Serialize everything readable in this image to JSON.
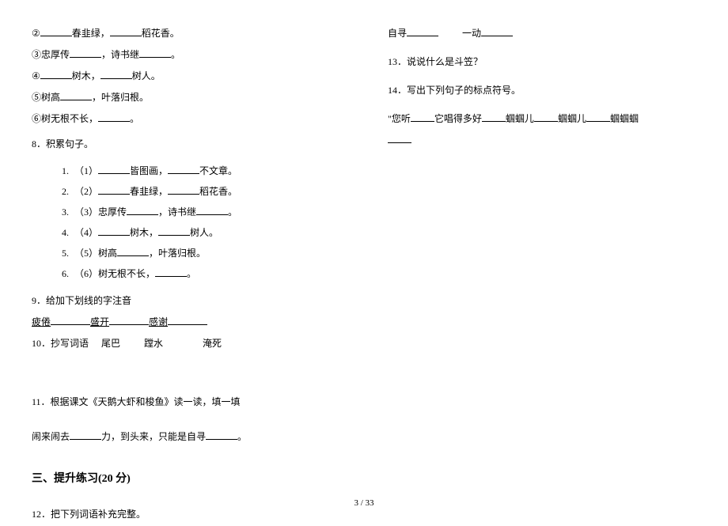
{
  "left": {
    "lines_top": {
      "l2": {
        "a": "②",
        "m": "春韭绿，",
        "e": "稻花香。"
      },
      "l3": {
        "a": "③忠厚传",
        "m": "，诗书继",
        "e": "。"
      },
      "l4": {
        "a": "④",
        "m": "树木，",
        "e": "树人。"
      },
      "l5": {
        "a": "⑤树高",
        "m": "，叶落归根。"
      },
      "l6": {
        "a": "⑥树无根不长，",
        "e": "。"
      }
    },
    "q8_title": "8．积累句子。",
    "q8_list": {
      "i1": {
        "a": "（1）",
        "m": "皆图画，",
        "e": "不文章。"
      },
      "i2": {
        "a": "（2）",
        "m": "春韭绿，",
        "e": "稻花香。"
      },
      "i3": {
        "a": "（3）忠厚传",
        "m": "，诗书继",
        "e": "。"
      },
      "i4": {
        "a": "（4）",
        "m": "树木，",
        "e": "树人。"
      },
      "i5": {
        "a": "（5）树高",
        "m": "，叶落归根。"
      },
      "i6": {
        "a": "（6）树无根不长，",
        "e": "。"
      }
    },
    "q9_title": "9．给加下划线的字注音",
    "q9_line": {
      "a": "疲倦",
      "b": "盛开",
      "c": "感谢"
    },
    "q10_title": "10．抄写词语",
    "q10_words": {
      "a": "尾巴",
      "b": "蹚水",
      "c": "淹死"
    },
    "q11_title": "11．根据课文《天鹅大虾和梭鱼》读一读，填一填",
    "q11_line": {
      "a": "闹来闹去",
      "b": "力，到头来，只能是自寻",
      "c": "。"
    },
    "section3_title": "三、提升练习(20 分)",
    "q12_title": "12．把下列词语补充完整。"
  },
  "right": {
    "line1": {
      "a": "自寻",
      "b": "一动"
    },
    "q13": "13．说说什么是斗笠？",
    "q14_title": "14．写出下列句子的标点符号。",
    "q14_line": {
      "a": "\"您听",
      "b": "它唱得多好",
      "c": "蝈蝈儿",
      "d": "蝈蝈儿",
      "e": "蝈蝈蝈"
    }
  },
  "page_num": "3 / 33"
}
